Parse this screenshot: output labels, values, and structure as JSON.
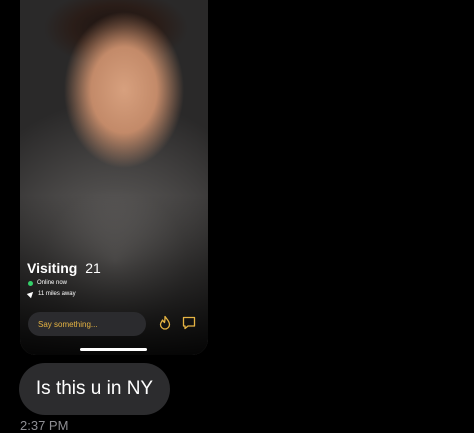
{
  "profile": {
    "name": "Visiting",
    "age": "21",
    "status": "Online now",
    "distance": "11 miles away",
    "status_color": "#34d06a"
  },
  "composer": {
    "placeholder": "Say something...",
    "accent_color": "#e6b443",
    "icons": [
      "flame-icon",
      "chat-bubble-icon"
    ]
  },
  "message": {
    "text": "Is this u in NY",
    "time": "2:37 PM"
  }
}
